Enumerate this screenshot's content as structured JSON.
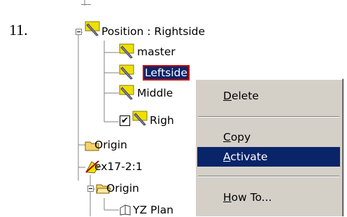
{
  "step": "11.",
  "tree": {
    "position_node": "Position : Rightside",
    "children": [
      "master",
      "Leftside",
      "Middle",
      "Righ"
    ],
    "rightside_checked": "✔",
    "origin": "Origin",
    "part": "ex17-2:1",
    "part_origin": "Origin",
    "yz_plane": "YZ Plan"
  },
  "menu": {
    "items": [
      {
        "mnemonic": "D",
        "rest": "elete"
      },
      {
        "mnemonic": "C",
        "rest": "opy"
      },
      {
        "mnemonic": "A",
        "rest": "ctivate"
      },
      {
        "mnemonic": "H",
        "rest": "ow To..."
      }
    ],
    "active_item": "Activate"
  },
  "colors": {
    "highlight": "#0a246a",
    "menu_background": "#d4d0c8",
    "selection_border": "#cc0000",
    "folder_yellow": "#f5d36b",
    "flag_yellow": "#f0e000"
  }
}
